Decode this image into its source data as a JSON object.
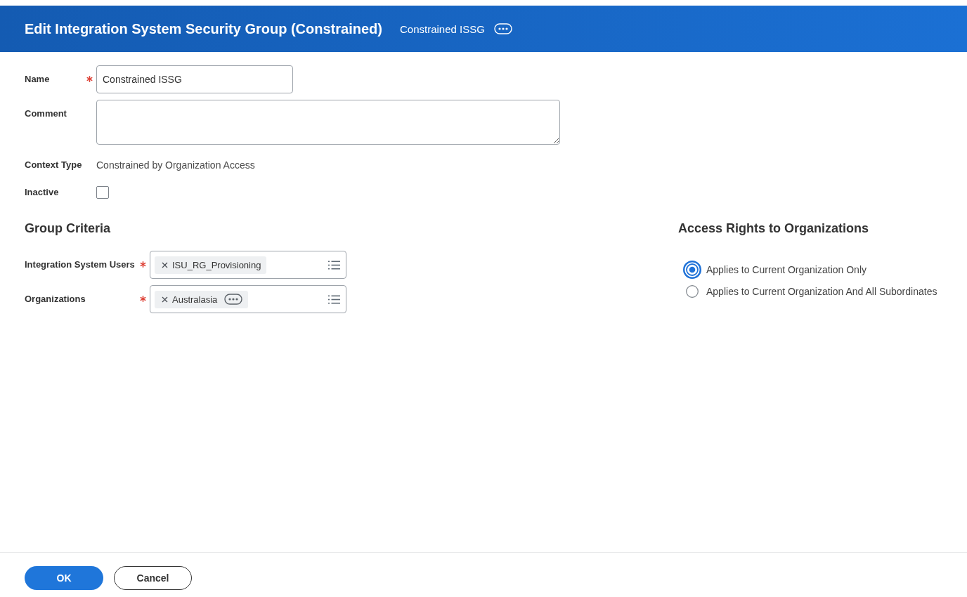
{
  "header": {
    "title": "Edit Integration System Security Group (Constrained)",
    "subtitle": "Constrained ISSG"
  },
  "fields": [
    {
      "kind": "text",
      "label": "Name",
      "required": true,
      "value": "Constrained ISSG"
    },
    {
      "kind": "textarea",
      "label": "Comment",
      "required": false
    },
    {
      "kind": "static",
      "label": "Context Type",
      "required": false,
      "value": "Constrained by Organization Access"
    },
    {
      "kind": "checkbox",
      "label": "Inactive",
      "required": false,
      "checked": false
    }
  ],
  "group_criteria": {
    "title": "Group Criteria",
    "fields": [
      {
        "label": "Integration System Users",
        "required": true,
        "items": [
          {
            "text": "ISU_RG_Provisioning",
            "related_actions": false
          }
        ]
      },
      {
        "label": "Organizations",
        "required": true,
        "items": [
          {
            "text": "Australasia",
            "related_actions": true
          }
        ]
      }
    ]
  },
  "access_rights": {
    "title": "Access Rights to Organizations",
    "options": [
      {
        "label": "Applies to Current Organization Only",
        "selected": true
      },
      {
        "label": "Applies to Current Organization And All Subordinates",
        "selected": false
      }
    ]
  },
  "buttons": [
    {
      "kind": "primary",
      "label": "OK"
    },
    {
      "kind": "secondary",
      "label": "Cancel"
    }
  ]
}
